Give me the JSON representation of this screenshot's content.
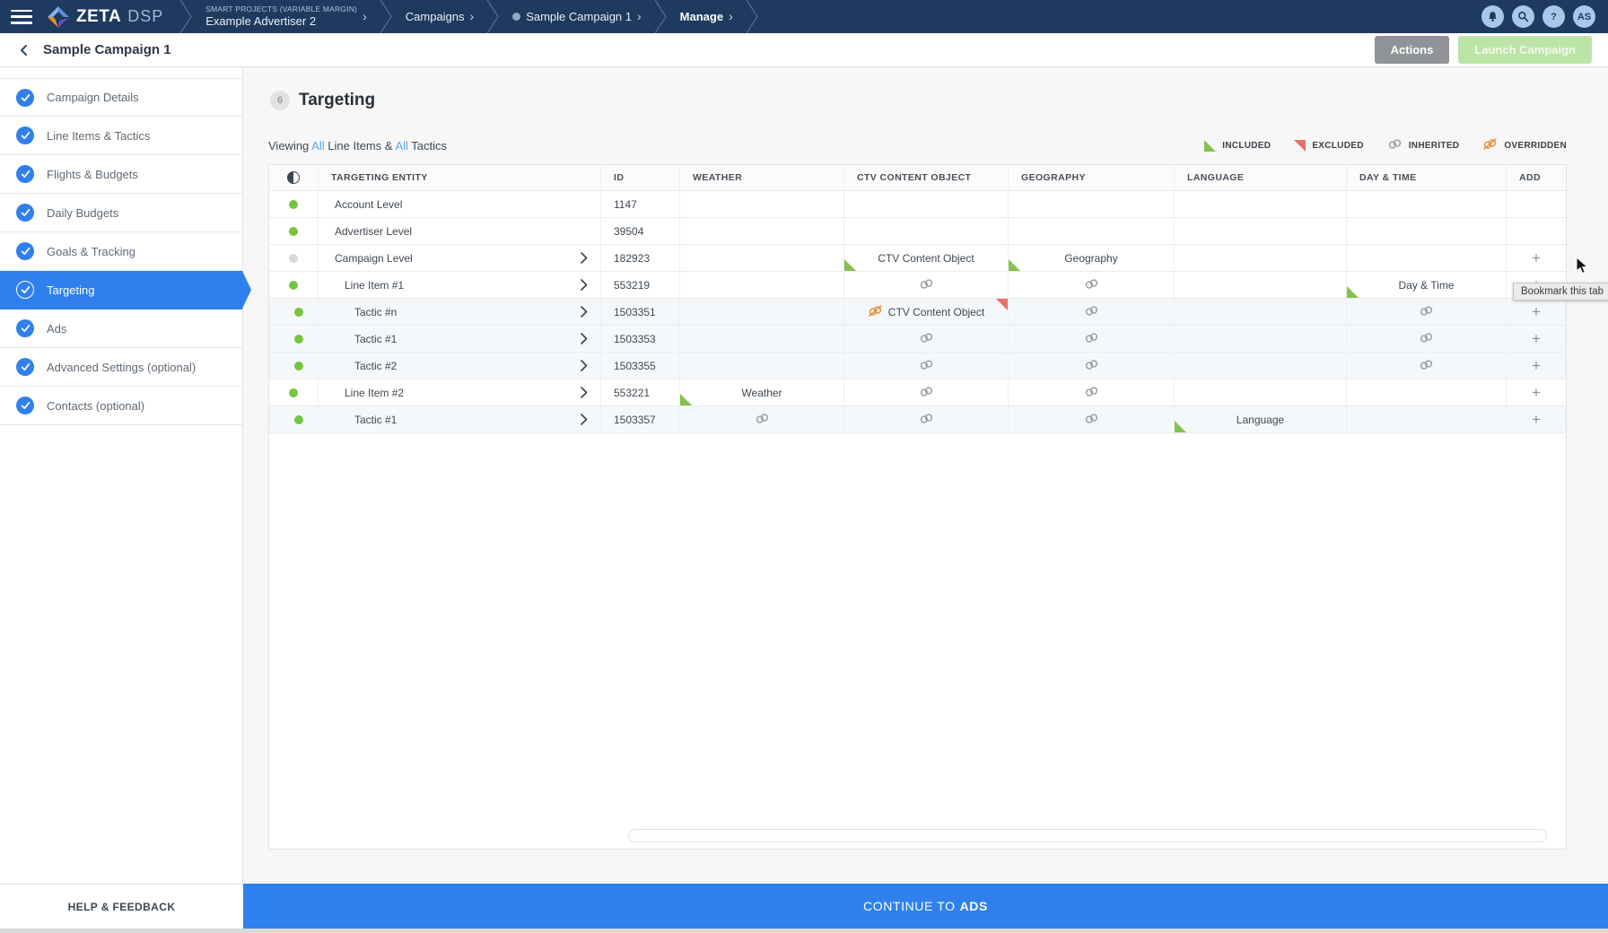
{
  "navbar": {
    "logo_text": "ZETA",
    "logo_suffix": "DSP",
    "breadcrumbs": [
      {
        "eyebrow": "SMART PROJECTS (VARIABLE MARGIN)",
        "label": "Example Advertiser 2",
        "dot": false,
        "bold": false
      },
      {
        "eyebrow": "",
        "label": "Campaigns",
        "dot": false,
        "bold": false
      },
      {
        "eyebrow": "",
        "label": "Sample Campaign 1",
        "dot": true,
        "bold": false
      },
      {
        "eyebrow": "",
        "label": "Manage",
        "dot": false,
        "bold": true
      }
    ],
    "avatar": "AS"
  },
  "header": {
    "title": "Sample Campaign 1",
    "actions_label": "Actions",
    "launch_label": "Launch Campaign"
  },
  "sidebar": {
    "items": [
      {
        "label": "Campaign Details",
        "active": false
      },
      {
        "label": "Line Items & Tactics",
        "active": false
      },
      {
        "label": "Flights & Budgets",
        "active": false
      },
      {
        "label": "Daily Budgets",
        "active": false
      },
      {
        "label": "Goals & Tracking",
        "active": false
      },
      {
        "label": "Targeting",
        "active": true
      },
      {
        "label": "Ads",
        "active": false
      },
      {
        "label": "Advanced Settings (optional)",
        "active": false
      },
      {
        "label": "Contacts (optional)",
        "active": false
      }
    ],
    "help_label": "HELP & FEEDBACK"
  },
  "section": {
    "number": "6",
    "title": "Targeting"
  },
  "viewing": {
    "prefix": "Viewing",
    "all1": "All",
    "mid": "Line Items &",
    "all2": "All",
    "suffix": "Tactics"
  },
  "legend": [
    {
      "type": "included",
      "label": "INCLUDED"
    },
    {
      "type": "excluded",
      "label": "EXCLUDED"
    },
    {
      "type": "inherited",
      "label": "INHERITED"
    },
    {
      "type": "overridden",
      "label": "OVERRIDDEN"
    }
  ],
  "table": {
    "columns": [
      "TARGETING ENTITY",
      "ID",
      "WEATHER",
      "CTV CONTENT OBJECT",
      "GEOGRAPHY",
      "LANGUAGE",
      "DAY & TIME",
      "ADD"
    ],
    "rows": [
      {
        "entity": "Account Level",
        "id": "1147",
        "level": 0,
        "dot": "green",
        "chevron": false,
        "shaded": false,
        "add": false,
        "cells": {}
      },
      {
        "entity": "Advertiser Level",
        "id": "39504",
        "level": 0,
        "dot": "green",
        "chevron": false,
        "shaded": false,
        "add": false,
        "cells": {}
      },
      {
        "entity": "Campaign Level",
        "id": "182923",
        "level": 0,
        "dot": "gray",
        "chevron": true,
        "shaded": false,
        "add": true,
        "cells": {
          "ctv": {
            "label": "CTV Content Object",
            "flag": "included"
          },
          "geography": {
            "label": "Geography",
            "flag": "included"
          }
        }
      },
      {
        "entity": "Line Item #1",
        "id": "553219",
        "level": 1,
        "dot": "green",
        "chevron": true,
        "shaded": false,
        "add": true,
        "cells": {
          "ctv": {
            "inherited": true
          },
          "geography": {
            "inherited": true
          },
          "daytime": {
            "label": "Day & Time",
            "flag": "included"
          }
        }
      },
      {
        "entity": "Tactic #n",
        "id": "1503351",
        "level": 2,
        "dot": "green",
        "chevron": true,
        "shaded": true,
        "add": true,
        "cells": {
          "ctv": {
            "label": "CTV Content Object",
            "overridden": true,
            "flag": "excluded"
          },
          "geography": {
            "inherited": true
          },
          "daytime": {
            "inherited": true
          }
        }
      },
      {
        "entity": "Tactic #1",
        "id": "1503353",
        "level": 2,
        "dot": "green",
        "chevron": true,
        "shaded": true,
        "add": true,
        "cells": {
          "ctv": {
            "inherited": true
          },
          "geography": {
            "inherited": true
          },
          "daytime": {
            "inherited": true
          }
        }
      },
      {
        "entity": "Tactic #2",
        "id": "1503355",
        "level": 2,
        "dot": "green",
        "chevron": true,
        "shaded": true,
        "add": true,
        "cells": {
          "ctv": {
            "inherited": true
          },
          "geography": {
            "inherited": true
          },
          "daytime": {
            "inherited": true
          }
        }
      },
      {
        "entity": "Line Item #2",
        "id": "553221",
        "level": 1,
        "dot": "green",
        "chevron": true,
        "shaded": false,
        "add": true,
        "cells": {
          "weather": {
            "label": "Weather",
            "flag": "included"
          },
          "ctv": {
            "inherited": true
          },
          "geography": {
            "inherited": true
          }
        }
      },
      {
        "entity": "Tactic #1",
        "id": "1503357",
        "level": 2,
        "dot": "green",
        "chevron": true,
        "shaded": true,
        "add": true,
        "cells": {
          "weather": {
            "inherited": true
          },
          "ctv": {
            "inherited": true
          },
          "geography": {
            "inherited": true
          },
          "language": {
            "label": "Language",
            "flag": "included"
          }
        }
      }
    ]
  },
  "tooltip": "Bookmark this tab",
  "footer": {
    "continue_prefix": "CONTINUE TO",
    "continue_bold": "ADS"
  },
  "colors": {
    "navbar": "#1e3a5e",
    "accent_blue": "#2f80ed",
    "included_green": "#85c14d",
    "excluded_red": "#e57368",
    "overridden_orange": "#e2913f",
    "inherited_gray": "#9aa0a6",
    "status_green": "#74c63e"
  }
}
